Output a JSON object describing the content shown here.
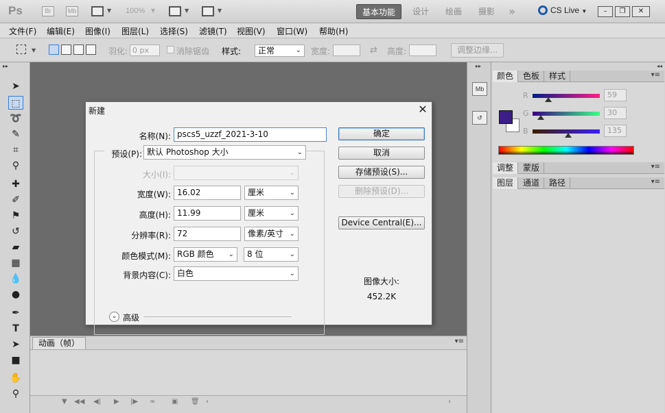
{
  "appbar": {
    "logo": "Ps",
    "bridge": "Br",
    "mini_bridge": "Mb",
    "zoom": "100%",
    "workspaces": [
      "基本功能",
      "设计",
      "绘画",
      "摄影"
    ],
    "more": "»",
    "cs_live": "CS Live",
    "window_controls": [
      "–",
      "❐",
      "✕"
    ]
  },
  "menubar": {
    "items": [
      "文件(F)",
      "编辑(E)",
      "图像(I)",
      "图层(L)",
      "选择(S)",
      "滤镜(T)",
      "视图(V)",
      "窗口(W)",
      "帮助(H)"
    ]
  },
  "options": {
    "feather_label": "羽化:",
    "feather_value": "0 px",
    "antialias_label": "消除锯齿",
    "style_label": "样式:",
    "style_value": "正常",
    "width_label": "宽度:",
    "height_label": "高度:",
    "refine_edge": "调整边缘..."
  },
  "anim_panel": {
    "tab": "动画（帧）"
  },
  "color_panel": {
    "tabs": [
      "颜色",
      "色板",
      "样式"
    ],
    "r_label": "R",
    "g_label": "G",
    "b_label": "B",
    "r_value": "59",
    "g_value": "30",
    "b_value": "135",
    "r_level": 0.23,
    "g_level": 0.12,
    "b_level": 0.53,
    "foreground_color": "#3b1e87",
    "background_color": "#ffffff"
  },
  "adjust_panel": {
    "tabs": [
      "调整",
      "蒙版"
    ]
  },
  "layers_panel": {
    "tabs": [
      "图层",
      "通道",
      "路径"
    ]
  },
  "dialog": {
    "title": "新建",
    "name_label": "名称(N):",
    "name_value": "pscs5_uzzf_2021-3-10",
    "preset_label": "预设(P):",
    "preset_value": "默认 Photoshop 大小",
    "size_label": "大小(I):",
    "size_value": "",
    "width_label": "宽度(W):",
    "width_value": "16.02",
    "width_unit": "厘米",
    "height_label": "高度(H):",
    "height_value": "11.99",
    "height_unit": "厘米",
    "resolution_label": "分辨率(R):",
    "resolution_value": "72",
    "resolution_unit": "像素/英寸",
    "color_mode_label": "颜色模式(M):",
    "color_mode_value": "RGB 颜色",
    "bit_depth": "8 位",
    "background_label": "背景内容(C):",
    "background_value": "白色",
    "advanced_label": "高级",
    "ok": "确定",
    "cancel": "取消",
    "save_preset": "存储预设(S)...",
    "delete_preset": "删除预设(D)...",
    "device_central": "Device Central(E)...",
    "image_size_label": "图像大小:",
    "image_size_value": "452.2K"
  }
}
